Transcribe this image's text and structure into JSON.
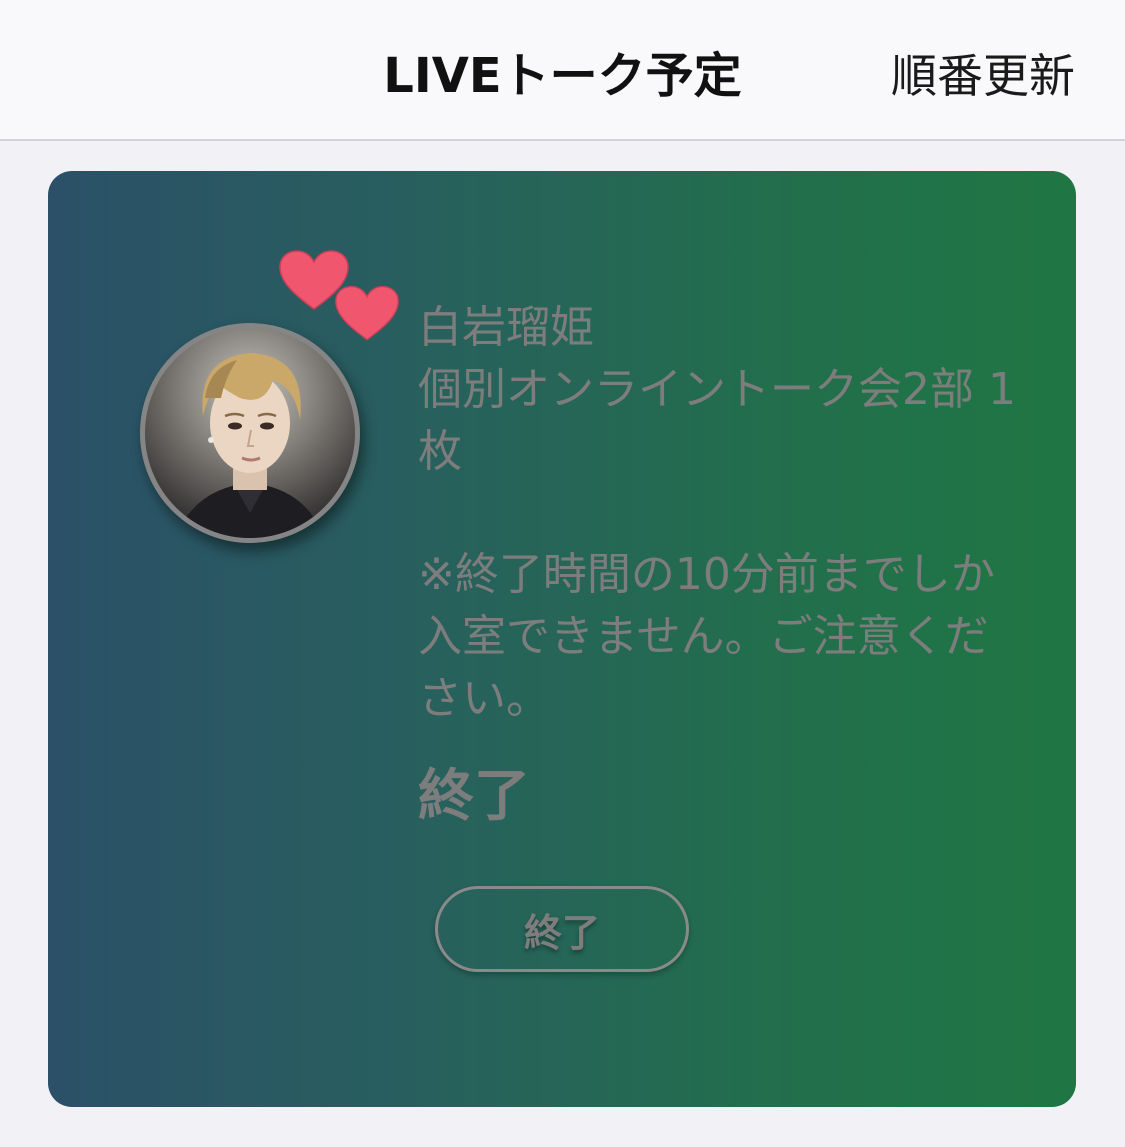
{
  "nav": {
    "title": "LIVEトーク予定",
    "action_label": "順番更新"
  },
  "card": {
    "artist_name": "白岩瑠姫",
    "event_title": "個別オンライントーク会2部 1枚",
    "notice": "※終了時間の10分前までしか入室できません。ご注意ください。",
    "status": "終了",
    "button_label": "終了",
    "gradient_colors": [
      "#2b5068",
      "#1f7643"
    ],
    "heart_color": "#f0566e",
    "text_color": "#7d7d7d"
  }
}
